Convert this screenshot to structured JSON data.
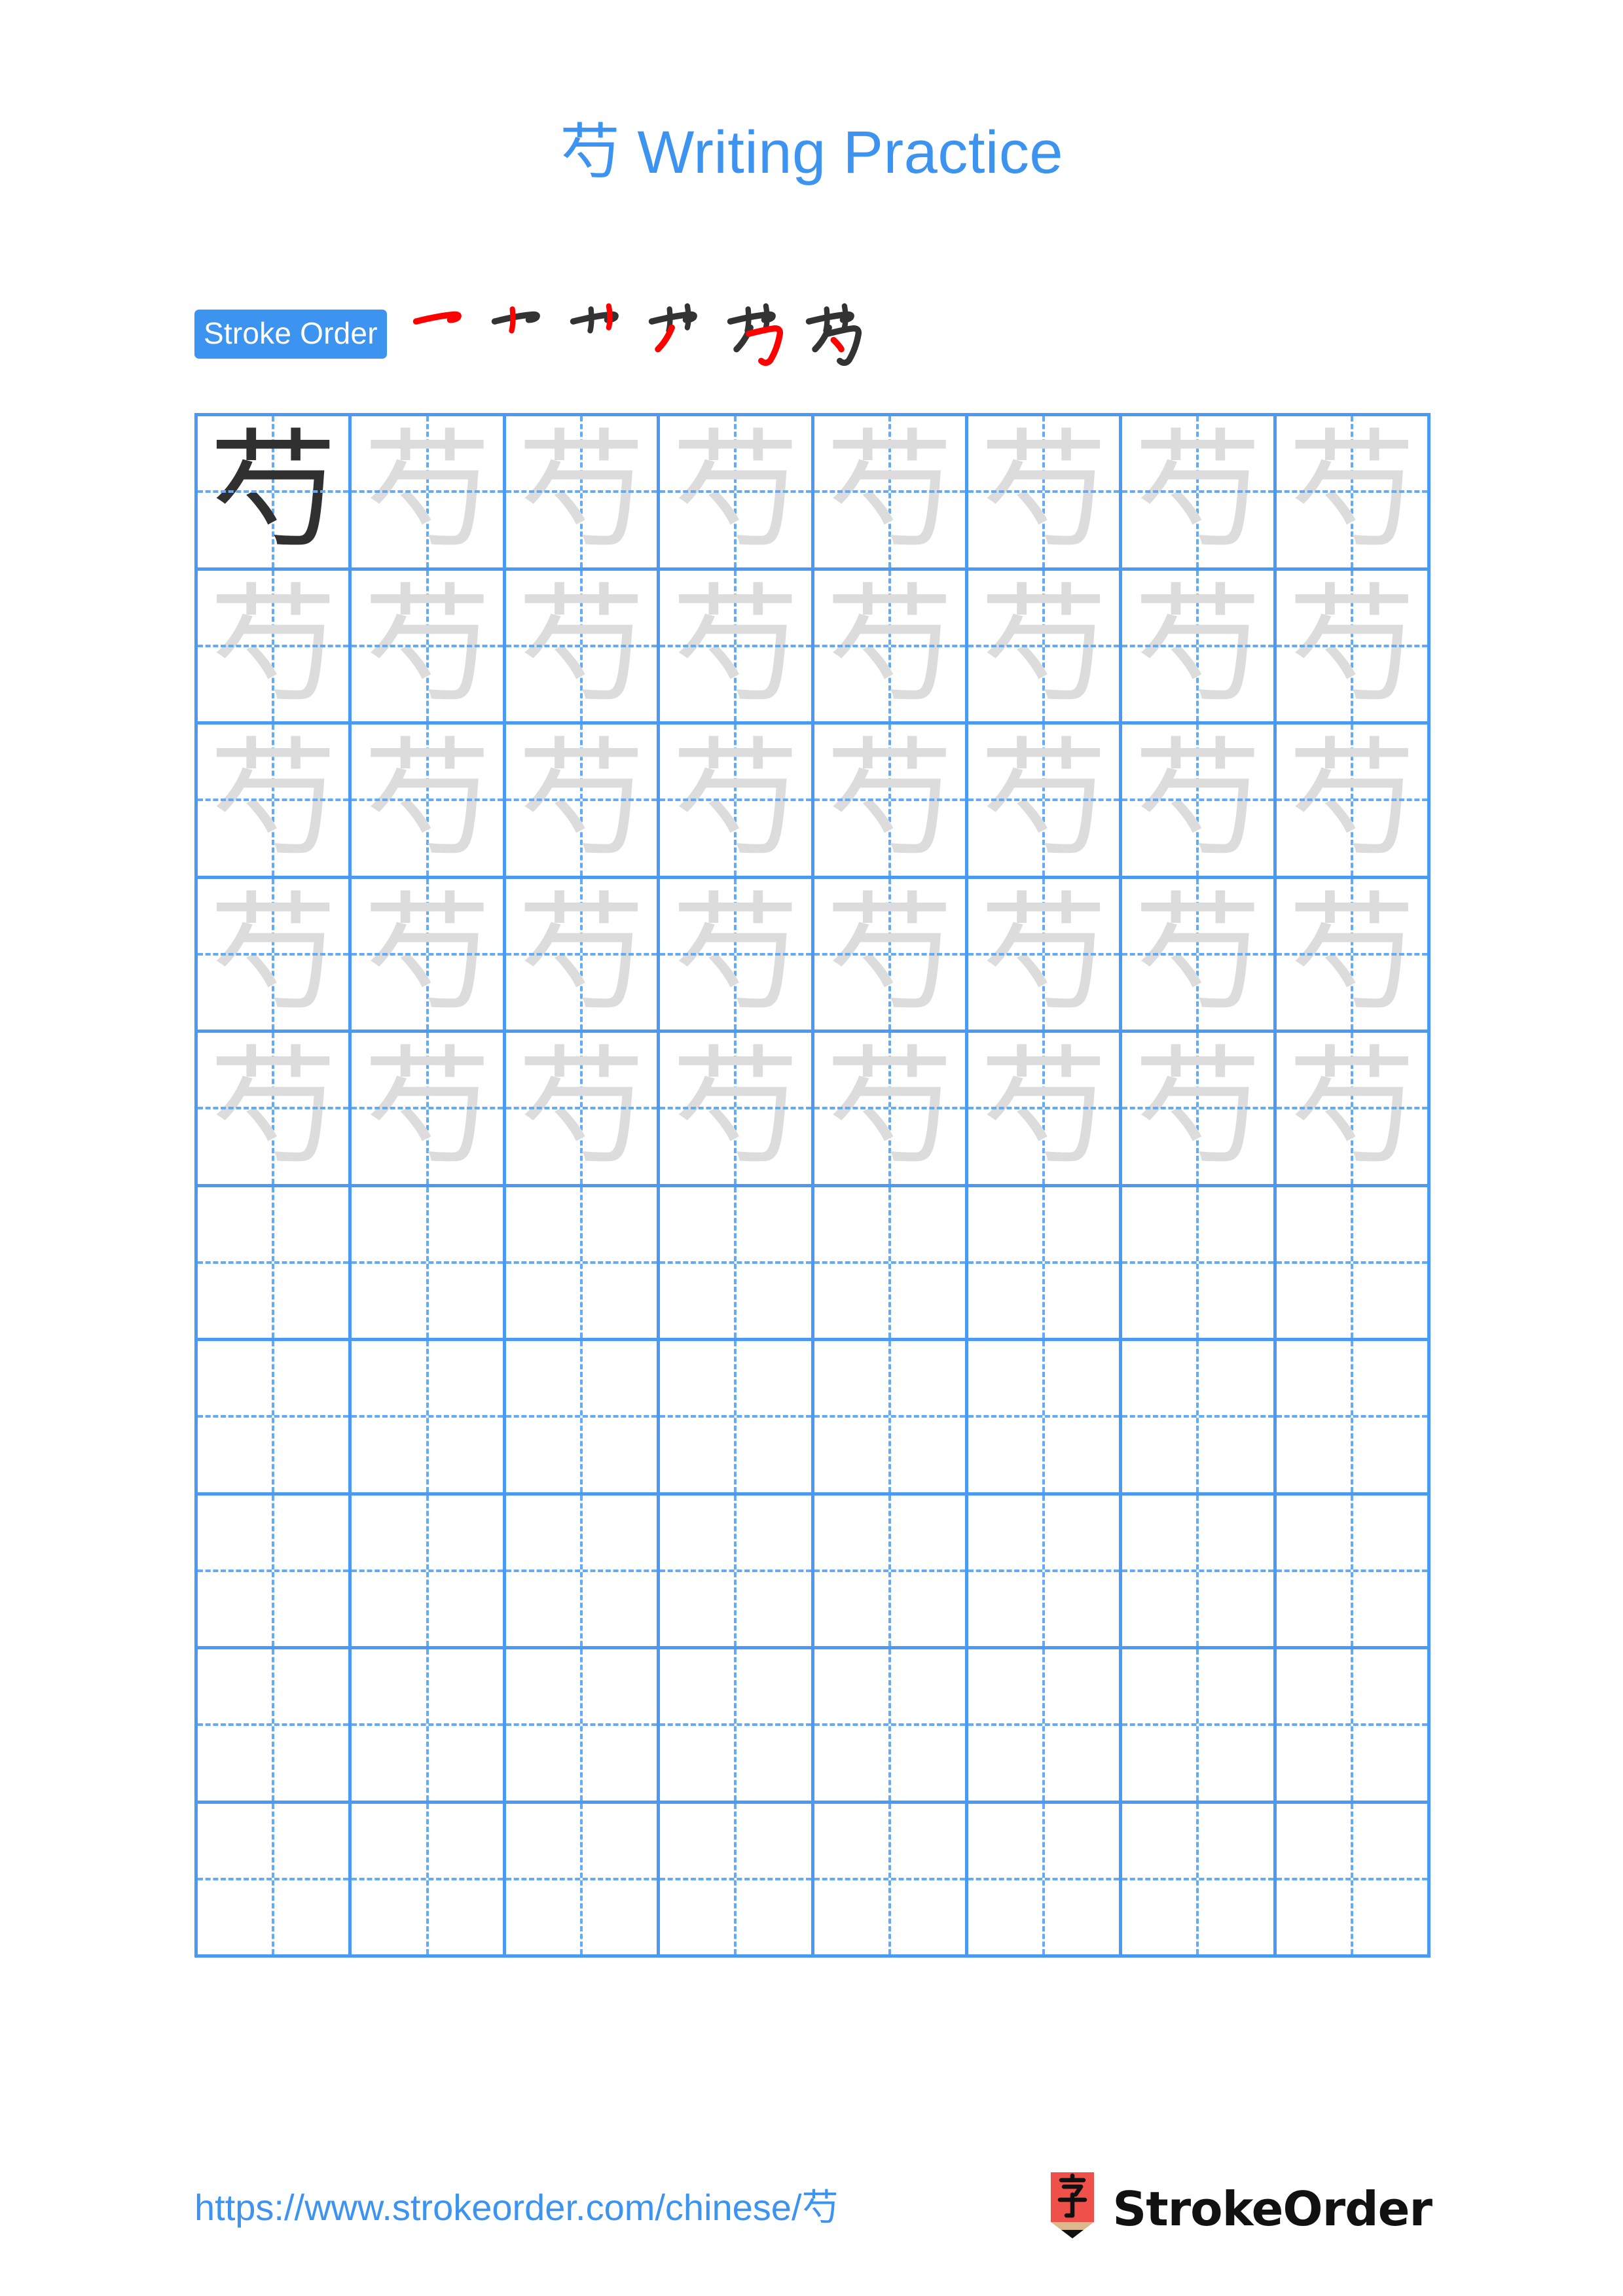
{
  "page": {
    "character": "芍",
    "title": "芍 Writing Practice",
    "accent_color": "#3d93f0",
    "grid_line_color": "#4a9af5",
    "guide_line_color": "#63aaf7",
    "model_char_color": "#303030",
    "trace_char_color": "#dcdcdc",
    "stroke_new_color": "#ff0000",
    "stroke_done_color": "#333333",
    "background_color": "#ffffff"
  },
  "stroke_order": {
    "badge_label": "Stroke Order",
    "total_strokes": 6,
    "steps": [
      {
        "index": 1,
        "label": "一",
        "new_stroke": "horizontal-1"
      },
      {
        "index": 2,
        "label": "十",
        "new_stroke": "vertical-left"
      },
      {
        "index": 3,
        "label": "艹",
        "new_stroke": "vertical-right"
      },
      {
        "index": 4,
        "label": "艹'",
        "new_stroke": "left-falling"
      },
      {
        "index": 5,
        "label": "芍",
        "new_stroke": "horizontal-hook"
      },
      {
        "index": 6,
        "label": "芍",
        "new_stroke": "dot"
      }
    ]
  },
  "grid": {
    "columns": 8,
    "rows": 10,
    "filled_rows": 5,
    "empty_rows": 5,
    "model_cell": {
      "row": 1,
      "column": 1
    },
    "cell_character": "芍"
  },
  "footer": {
    "url": "https://www.strokeorder.com/chinese/芍",
    "logo_text": "StrokeOrder",
    "logo_character": "字",
    "logo_body_color": "#f0504a",
    "logo_wood_color": "#dbb98c",
    "logo_tip_color": "#111111"
  }
}
